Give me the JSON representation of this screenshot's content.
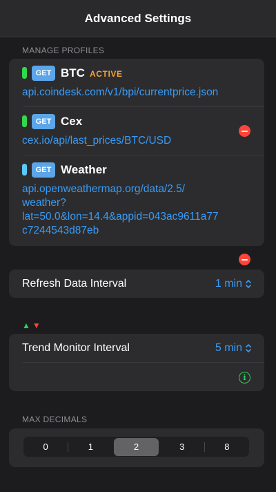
{
  "nav": {
    "title": "Advanced Settings"
  },
  "sections": {
    "profiles_header": "MANAGE PROFILES",
    "max_decimals_header": "MAX DECIMALS"
  },
  "profiles": [
    {
      "name": "BTC",
      "method": "GET",
      "status": "ACTIVE",
      "url": "api.coindesk.com/v1/bpi/currentprice.json",
      "indicator_color": "#32d74b"
    },
    {
      "name": "Cex",
      "method": "GET",
      "url": "cex.io/api/last_prices/BTC/USD",
      "indicator_color": "#32d74b"
    },
    {
      "name": "Weather",
      "method": "GET",
      "url_lines": [
        "api.openweathermap.org/data/2.5/",
        "weather?",
        "lat=50.0&lon=14.4&appid=043ac9611a77",
        "c7244543d87eb"
      ],
      "indicator_color": "#5ac8fa"
    }
  ],
  "refresh": {
    "label": "Refresh Data Interval",
    "value": "1 min"
  },
  "trend": {
    "label": "Trend Monitor Interval",
    "value": "5 min",
    "arrow_up": "▲",
    "arrow_down": "▼"
  },
  "max_decimals": {
    "options": [
      "0",
      "1",
      "2",
      "3",
      "8"
    ],
    "selected": "2"
  },
  "colors": {
    "accent": "#3a9bf5",
    "active": "#f2a33a",
    "delete": "#ff453a",
    "info": "#30d158"
  }
}
